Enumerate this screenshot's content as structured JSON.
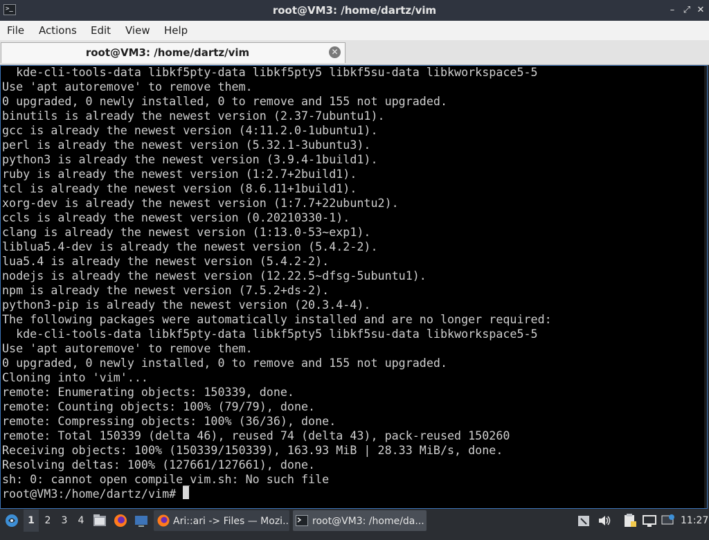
{
  "window": {
    "title": "root@VM3: /home/dartz/vim",
    "app_icon_glyph": ">_",
    "controls": {
      "minimize": "–",
      "maximize": "⤢",
      "close": "✕"
    }
  },
  "menu": [
    "File",
    "Actions",
    "Edit",
    "View",
    "Help"
  ],
  "tab": {
    "label": "root@VM3: /home/dartz/vim",
    "close_glyph": "✕"
  },
  "terminal": {
    "lines": [
      "  kde-cli-tools-data libkf5pty-data libkf5pty5 libkf5su-data libkworkspace5-5",
      "Use 'apt autoremove' to remove them.",
      "0 upgraded, 0 newly installed, 0 to remove and 155 not upgraded.",
      "binutils is already the newest version (2.37-7ubuntu1).",
      "gcc is already the newest version (4:11.2.0-1ubuntu1).",
      "perl is already the newest version (5.32.1-3ubuntu3).",
      "python3 is already the newest version (3.9.4-1build1).",
      "ruby is already the newest version (1:2.7+2build1).",
      "tcl is already the newest version (8.6.11+1build1).",
      "xorg-dev is already the newest version (1:7.7+22ubuntu2).",
      "ccls is already the newest version (0.20210330-1).",
      "clang is already the newest version (1:13.0-53~exp1).",
      "liblua5.4-dev is already the newest version (5.4.2-2).",
      "lua5.4 is already the newest version (5.4.2-2).",
      "nodejs is already the newest version (12.22.5~dfsg-5ubuntu1).",
      "npm is already the newest version (7.5.2+ds-2).",
      "python3-pip is already the newest version (20.3.4-4).",
      "The following packages were automatically installed and are no longer required:",
      "  kde-cli-tools-data libkf5pty-data libkf5pty5 libkf5su-data libkworkspace5-5",
      "Use 'apt autoremove' to remove them.",
      "0 upgraded, 0 newly installed, 0 to remove and 155 not upgraded.",
      "Cloning into 'vim'...",
      "remote: Enumerating objects: 150339, done.",
      "remote: Counting objects: 100% (79/79), done.",
      "remote: Compressing objects: 100% (36/36), done.",
      "remote: Total 150339 (delta 46), reused 74 (delta 43), pack-reused 150260",
      "Receiving objects: 100% (150339/150339), 163.93 MiB | 28.33 MiB/s, done.",
      "Resolving deltas: 100% (127661/127661), done.",
      "sh: 0: cannot open compile_vim.sh: No such file",
      "root@VM3:/home/dartz/vim# "
    ]
  },
  "taskbar": {
    "workspaces": [
      "1",
      "2",
      "3",
      "4"
    ],
    "tasks": [
      {
        "label": "Ari::ari -> Files — Mozi...",
        "icon": "firefox-icon"
      },
      {
        "label": "root@VM3: /home/da...",
        "icon": "terminal-icon"
      }
    ],
    "clock": "11:27"
  },
  "colors": {
    "titlebar": "#2f343f",
    "terminal_bg": "#000000",
    "terminal_fg": "#cfcfcf",
    "taskbar": "#2b2e33",
    "accent": "#3d74b8"
  }
}
